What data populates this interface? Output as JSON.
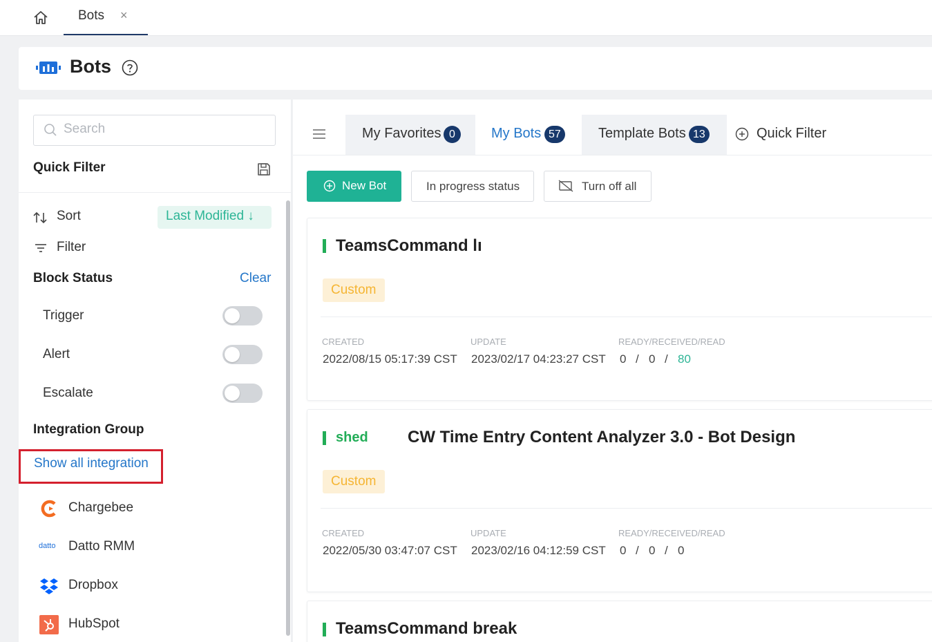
{
  "tabstrip": {
    "tab_label": "Bots",
    "close_glyph": "×"
  },
  "header": {
    "title": "Bots"
  },
  "sidebar": {
    "search_placeholder": "Search",
    "quick_filter_title": "Quick Filter",
    "sort_label": "Sort",
    "sort_value": "Last Modified ↓",
    "filter_label": "Filter",
    "block_status_title": "Block Status",
    "clear_label": "Clear",
    "toggles": [
      {
        "label": "Trigger",
        "on": false
      },
      {
        "label": "Alert",
        "on": false
      },
      {
        "label": "Escalate",
        "on": false
      }
    ],
    "integration_group_title": "Integration Group",
    "show_all_label": "Show all integration",
    "integrations": [
      {
        "label": "Chargebee",
        "icon": "chargebee-icon"
      },
      {
        "label": "Datto RMM",
        "icon": "datto-icon",
        "icon_text": "datto"
      },
      {
        "label": "Dropbox",
        "icon": "dropbox-icon"
      },
      {
        "label": "HubSpot",
        "icon": "hubspot-icon"
      }
    ]
  },
  "main": {
    "tabs": [
      {
        "label": "My Favorites",
        "count": "0"
      },
      {
        "label": "My Bots",
        "count": "57",
        "active": true
      },
      {
        "label": "Template Bots",
        "count": "13"
      }
    ],
    "quick_filter_label": "Quick Filter",
    "buttons": {
      "new_bot": "New Bot",
      "in_progress": "In progress status",
      "turn_off": "Turn off all"
    },
    "cards": [
      {
        "title": "TeamsCommand lı",
        "tag": "Custom",
        "created_label": "CREATED",
        "created": "2022/08/15 05:17:39 CST",
        "update_label": "UPDATE",
        "update": "2023/02/17 04:23:27 CST",
        "stats_label": "READY/RECEIVED/READ",
        "ready": "0",
        "received": "0",
        "read": "80"
      },
      {
        "status": "shed",
        "title": "CW Time Entry Content Analyzer 3.0 - Bot Design",
        "tag": "Custom",
        "created_label": "CREATED",
        "created": "2022/05/30 03:47:07 CST",
        "update_label": "UPDATE",
        "update": "2023/02/16 04:12:59 CST",
        "stats_label": "READY/RECEIVED/READ",
        "ready": "0",
        "received": "0",
        "read": "0"
      },
      {
        "title": "TeamsCommand break"
      }
    ],
    "stat_separator": "/"
  },
  "colors": {
    "accent_teal": "#1fb295",
    "navy_badge": "#17386b",
    "link_blue": "#2577c9",
    "status_green": "#22ad57",
    "custom_tag_bg": "#fdf0d6",
    "custom_tag_text": "#f5b533",
    "highlight_red": "#d4202e"
  }
}
